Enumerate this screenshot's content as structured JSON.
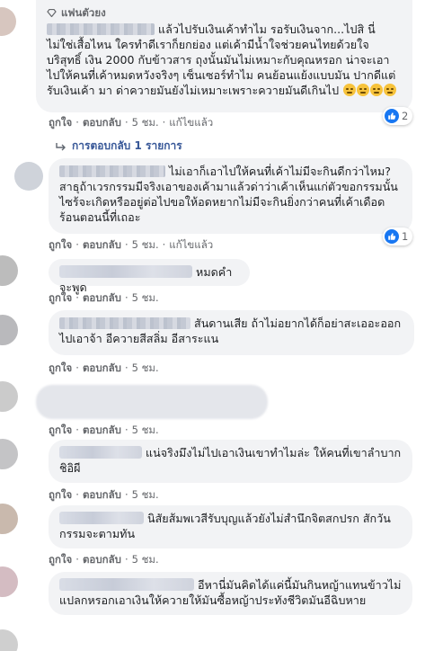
{
  "ui": {
    "like": "ถูกใจ",
    "reply": "ตอบกลับ",
    "edited": "แก้ไขแล้ว",
    "sep": "·"
  },
  "comments": [
    {
      "badge": "แฟนตัวยง",
      "text": "แล้วไปรับเงินเค้าทำไม รอรับเงินจาก...ไปสิ นี่ไม่ใช่เสื้อไหน ใครทำดีเราก็ยกย่อง แต่เค้ามีน้ำใจช่วยคนไทยด้วยใจบริสุทธิ์ เงิน 2000 กับข้าวสาร ถุงนั้นมันไม่เหมาะกับคุณหรอก น่าจะเอาไปให้คนที่เค้าหมดหวังจริงๆ เซ็นเซอร์ทำไม คนย้อนแย้งแบบมัน ปากดีแต่รับเงินเค้า มา ด่าควายมันยังไม่เหมาะเพราะควายมันดีเกินไป",
      "time": "5 ชม.",
      "reaction_count": "2"
    },
    {
      "text": "ไม่เอาก็เอาไปให้คนที่เค้าไม่มีจะกินดีกว่าไหม? สาธุถ้าเวรกรรมมีจริงเอาของเค้ามาแล้วด่าว่าเค้าเห็นแก่ตัวขอกรรมนั้นไซร้จะเกิดหรืออยู่ต่อไปขอให้อดหยากไม่มีจะกินยิ่งกว่าคนที่เค้าเดือดร้อนตอนนี้ที่เถอะ",
      "time": "5 ชม.",
      "reaction_count": "1"
    },
    {
      "text": "หมดคำจะพูด",
      "time": "5 ชม."
    },
    {
      "name_tail": "สันดานเสีย ถ้าไม่อยากได้ก็อย่าสะเออะออกไปเอาจ้า อีควายสีสลิ่ม อีสาระแน",
      "name_head": "P O U N I U   U N U M P H U A H",
      "time": "5 ชม."
    },
    {
      "time": "5 ชม."
    },
    {
      "text": "แน่จริงมึงไม่ไปเอาเงินเขาทำไมล่ะ ให้คนที่เขาลำบาก ชิอิผี",
      "time": "5 ชม."
    },
    {
      "text": "นิสัยส้มพเวสีรับบุญแล้วยังไม่สำนึกจิตสกปรก สักวันกรรมจะตามทัน",
      "time": "5 ชม."
    },
    {
      "text": "อีหานี่มันคิดได้แค่นี้มันกินหญ้าแทนข้าวไม่แปลกหรอกเอาเงินให้ควายให้มันซื้อหญ้าประทังชีวิตมันอีฉิบหาย"
    }
  ],
  "replies_link": "การตอบกลับ 1 รายการ",
  "colors": {
    "like_blue": "#1877f2",
    "bubble": "#f2f3f5",
    "meta": "#65676b",
    "link": "#385898"
  }
}
